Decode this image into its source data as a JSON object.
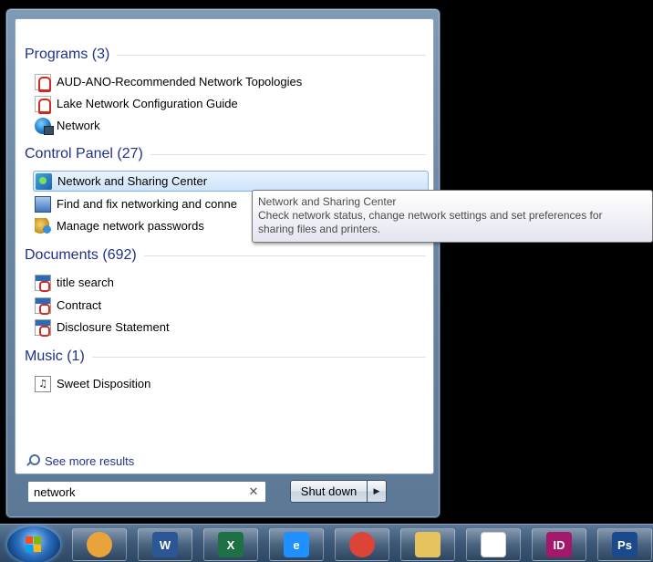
{
  "groups": [
    {
      "header": "Programs (3)",
      "items": [
        {
          "label": "AUD-ANO-Recommended Network Topologies",
          "icon": "pdf-icon"
        },
        {
          "label": "Lake Network Configuration Guide",
          "icon": "pdf-icon"
        },
        {
          "label": "Network",
          "icon": "globe-network-icon"
        }
      ]
    },
    {
      "header": "Control Panel (27)",
      "items": [
        {
          "label": "Network and Sharing Center",
          "icon": "network-sharing-center-icon",
          "selected": true
        },
        {
          "label": "Find and fix networking and conne",
          "icon": "troubleshoot-network-icon"
        },
        {
          "label": "Manage network passwords",
          "icon": "credential-manager-icon"
        }
      ]
    },
    {
      "header": "Documents (692)",
      "items": [
        {
          "label": "title search",
          "icon": "pdf-document-icon"
        },
        {
          "label": "Contract",
          "icon": "pdf-document-icon"
        },
        {
          "label": "Disclosure Statement",
          "icon": "pdf-document-icon"
        }
      ]
    },
    {
      "header": "Music (1)",
      "items": [
        {
          "label": "Sweet Disposition",
          "icon": "music-file-icon"
        }
      ]
    }
  ],
  "tooltip": {
    "title": "Network and Sharing Center",
    "line1": "Check network status, change network settings and set preferences for",
    "line2": "sharing files and printers."
  },
  "see_more": {
    "label": "See more results",
    "icon": "search-icon"
  },
  "search": {
    "value": "network",
    "clear_icon": "clear-icon"
  },
  "shutdown": {
    "label": "Shut down",
    "arrow_icon": "arrow-right-icon"
  },
  "taskbar": {
    "start_icon": "windows-start-orb-icon",
    "apps": [
      {
        "name": "outlook-icon",
        "text": "",
        "color": "#e8a33a"
      },
      {
        "name": "word-icon",
        "text": "W",
        "color": "#2b5797"
      },
      {
        "name": "excel-icon",
        "text": "X",
        "color": "#1e7145"
      },
      {
        "name": "internet-explorer-icon",
        "text": "e",
        "color": "#1e90ff"
      },
      {
        "name": "chrome-icon",
        "text": "",
        "color": "#db4437"
      },
      {
        "name": "file-explorer-icon",
        "text": "",
        "color": "#e6c35c"
      },
      {
        "name": "acrobat-icon",
        "text": "",
        "color": "#ffffff"
      },
      {
        "name": "indesign-icon",
        "text": "ID",
        "color": "#a3186b"
      },
      {
        "name": "photoshop-icon",
        "text": "Ps",
        "color": "#1b4a8c"
      }
    ]
  },
  "colors": {
    "header_blue": "#1e3287",
    "selection_border": "#86afe3",
    "taskbar": "#3c5876"
  }
}
